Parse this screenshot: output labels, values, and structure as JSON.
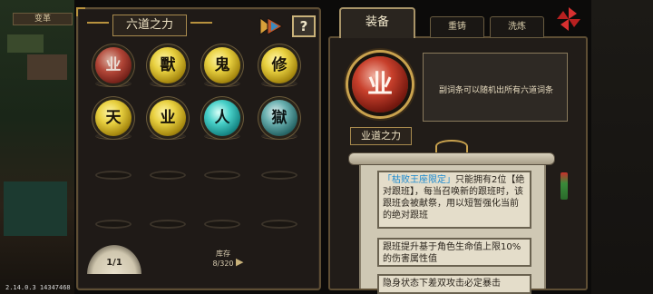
{
  "hud": {
    "top_label": "变革"
  },
  "version": "2.14.0.3  14347468",
  "left_panel": {
    "title": "六道之力",
    "help_label": "?",
    "orbs": [
      {
        "char": "业",
        "style": "red"
      },
      {
        "char": "獸",
        "style": "gold"
      },
      {
        "char": "鬼",
        "style": "gold"
      },
      {
        "char": "修",
        "style": "gold"
      },
      {
        "char": "天",
        "style": "gold"
      },
      {
        "char": "业",
        "style": "gold"
      },
      {
        "char": "人",
        "style": "teal"
      },
      {
        "char": "獄",
        "style": "slate"
      }
    ],
    "page_label": "1/1",
    "prev_arrow": "◀",
    "next_arrow": "▶",
    "stock_label": "库存",
    "stock_value": "8/320"
  },
  "tabs": {
    "equip": "装备",
    "reforge": "重铸",
    "wash": "洗炼"
  },
  "detail": {
    "orb_char": "业",
    "orb_name": "业道之力",
    "description": "副词条可以随机出所有六道词条"
  },
  "entries": [
    {
      "highlight": "「枯败王座限定」",
      "text": "只能拥有2位【绝对跟班】，每当召唤新的跟班时，该跟班会被献祭，用以短暂强化当前的绝对跟班"
    },
    {
      "highlight": "",
      "text": "跟班提升基于角色生命值上限10%的伤害属性值"
    },
    {
      "highlight": "",
      "text": "隐身状态下差双攻击必定暴击"
    }
  ],
  "colors": {
    "accent_gold": "#c9a24e",
    "highlight_blue": "#1c8ad0",
    "panel_bg": "#211c18"
  }
}
